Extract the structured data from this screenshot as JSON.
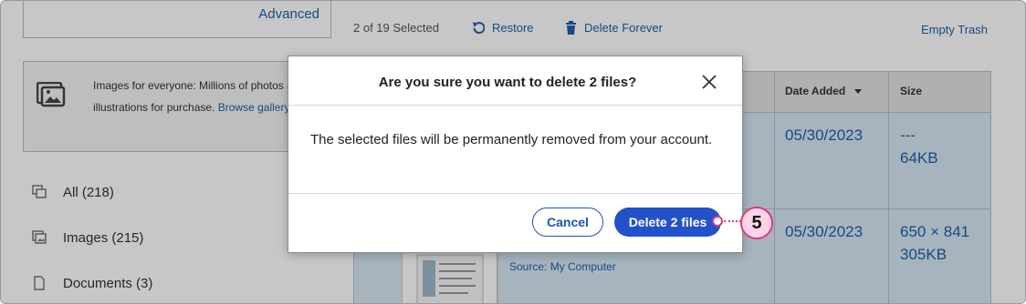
{
  "sidebar": {
    "advanced_label": "Advanced",
    "promo": {
      "text": "Images for everyone: Millions of photos and illustrations for purchase.",
      "link_browse": "Browse",
      "link_gallery": "gallery now"
    },
    "items": [
      {
        "label": "All (218)",
        "icon": "all-files-icon"
      },
      {
        "label": "Images (215)",
        "icon": "images-icon"
      },
      {
        "label": "Documents (3)",
        "icon": "document-icon"
      }
    ]
  },
  "toolbar": {
    "selected_count": "2 of 19 Selected",
    "restore_label": "Restore",
    "delete_forever_label": "Delete Forever",
    "empty_trash_label": "Empty Trash"
  },
  "table": {
    "columns": {
      "date_added": "Date Added",
      "size": "Size"
    },
    "rows": [
      {
        "date": "05/30/2023",
        "dimensions": "---",
        "size": "64KB"
      },
      {
        "date": "05/30/2023",
        "dimensions": "650 × 841",
        "size": "305KB",
        "source": "Source: My Computer"
      }
    ]
  },
  "modal": {
    "title": "Are you sure you want to delete 2 files?",
    "body": "The selected files will be permanently removed from your account.",
    "cancel_label": "Cancel",
    "confirm_label": "Delete 2 files"
  },
  "callout": {
    "step": "5"
  },
  "colors": {
    "link": "#1e5fa8",
    "primary_button": "#2251c9",
    "callout": "#d63b86",
    "callout_fill": "#ffd3e6"
  }
}
